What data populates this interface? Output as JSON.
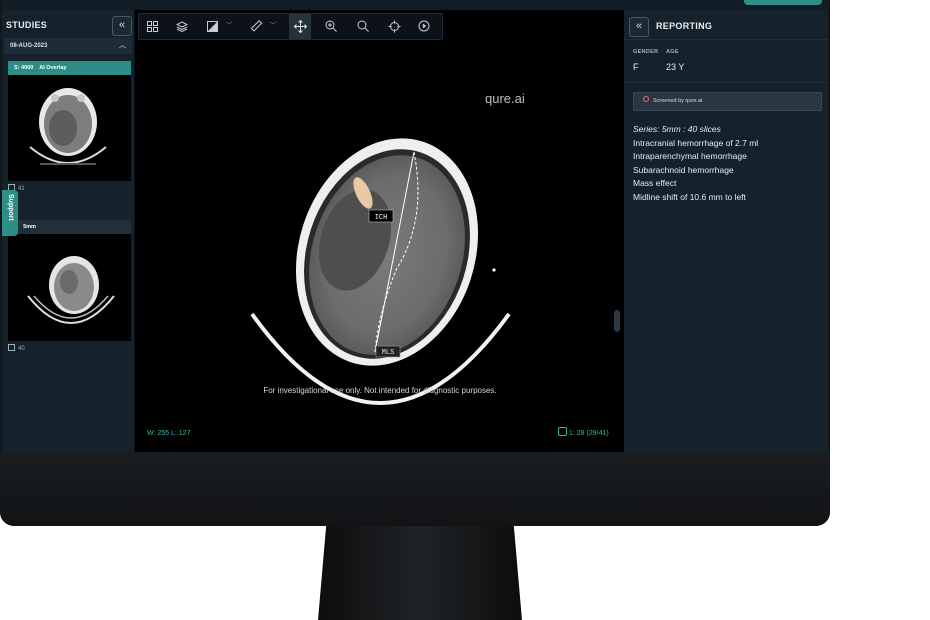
{
  "studies": {
    "title": "STUDIES",
    "collapse_icon": "«",
    "date": "08-AUG-2023",
    "series": [
      {
        "number": "S: 4000",
        "label": "AI Overlay",
        "count": "41",
        "header_color": "#2f8d87"
      },
      {
        "number": "2",
        "label": "5mm",
        "count": "40",
        "header_color": "#1f2f3b"
      }
    ]
  },
  "support": {
    "label": "Support"
  },
  "toolbar": {
    "icons": [
      "grid-layout-icon",
      "layers-icon",
      "contrast-icon",
      "ruler-icon",
      "pan-icon",
      "zoom-in-icon",
      "search-icon",
      "crosshair-icon",
      "play-icon"
    ]
  },
  "viewer": {
    "watermark": "qure.ai",
    "annotation_ich": "ICH",
    "annotation_mls": "MLS",
    "disclaimer": "For investigational use only. Not intended for diagnostic purposes.",
    "window_level": "W: 255  L: 127",
    "slice_info": "1: 28 (29/41)"
  },
  "reporting": {
    "title": "REPORTING",
    "collapse_icon": "«",
    "gender_label": "GENDER",
    "gender": "F",
    "age_label": "AGE",
    "age": "23 Y",
    "screened_by": "Screened by qure.ai",
    "series_line": "Series: 5mm : 40 slices",
    "findings": [
      "Intracranial hemorrhage of 2.7 ml",
      "Intraparenchymal hemorrhage",
      "Subarachnoid hemorrhage",
      "Mass effect",
      "Midline shift of 10.6 mm to left"
    ]
  },
  "colors": {
    "accent": "#2f8d87",
    "panel": "#15222c",
    "overlay_text": "#38b5ad"
  }
}
